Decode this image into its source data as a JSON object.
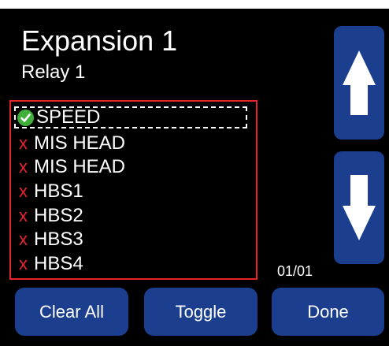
{
  "header": {
    "title": "Expansion 1",
    "subtitle": "Relay 1"
  },
  "list": {
    "items": [
      {
        "label": "SPEED",
        "status": "checked"
      },
      {
        "label": "MIS HEAD",
        "status": "unchecked",
        "mark": "x"
      },
      {
        "label": "MIS HEAD",
        "status": "unchecked",
        "mark": "x"
      },
      {
        "label": "HBS1",
        "status": "unchecked",
        "mark": "x"
      },
      {
        "label": "HBS2",
        "status": "unchecked",
        "mark": "x"
      },
      {
        "label": "HBS3",
        "status": "unchecked",
        "mark": "x"
      },
      {
        "label": "HBS4",
        "status": "unchecked",
        "mark": "x"
      }
    ],
    "selected_index": 0
  },
  "pager": {
    "page": "01/01"
  },
  "scroll": {
    "up_icon": "arrow-up-icon",
    "down_icon": "arrow-down-icon"
  },
  "buttons": {
    "clear_all": "Clear All",
    "toggle": "Toggle",
    "done": "Done"
  },
  "colors": {
    "background": "#000000",
    "button": "#1b3f8e",
    "list_border": "#e8242a",
    "x_mark": "#e8242a",
    "check": "#3fae3a",
    "text": "#ffffff"
  }
}
